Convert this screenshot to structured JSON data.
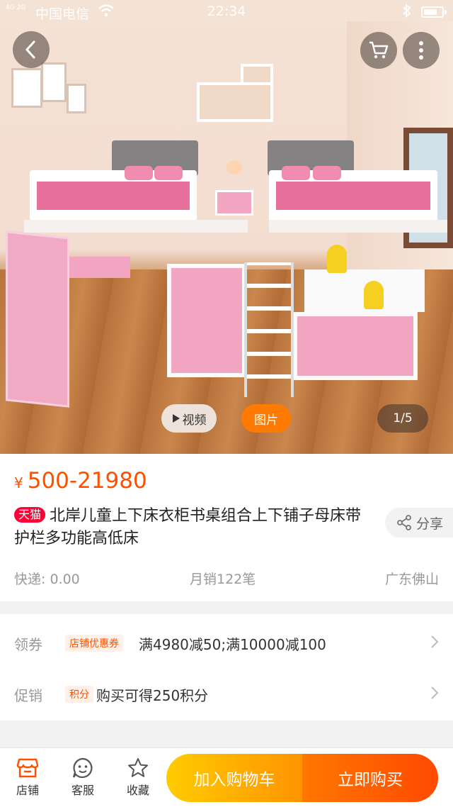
{
  "status_bar": {
    "signal": "4G 2G",
    "carrier": "中国电信",
    "time": "22:34"
  },
  "gallery": {
    "video_label": "视频",
    "image_label": "图片",
    "index": "1/5"
  },
  "product": {
    "currency": "¥",
    "price": "500-21980",
    "store_badge": "天猫",
    "title": "北岸儿童上下床衣柜书桌组合上下铺子母床带护栏多功能高低床",
    "share_label": "分享",
    "shipping": "快递: 0.00",
    "monthly_sales": "月销122笔",
    "location": "广东佛山"
  },
  "promotions": [
    {
      "label": "领券",
      "tag": "店铺优惠券",
      "text": "满4980减50;满10000减100"
    },
    {
      "label": "促销",
      "tag": "积分",
      "text": "购买可得250积分"
    }
  ],
  "bottom_bar": {
    "shop_label": "店铺",
    "service_label": "客服",
    "favorite_label": "收藏",
    "add_to_cart": "加入购物车",
    "buy_now": "立即购买"
  },
  "colors": {
    "accent": "#ff5000",
    "tmall_red": "#ff0036",
    "cart_yellow": "#ffcb00",
    "buy_orange": "#ff4900"
  },
  "icons": [
    "back-icon",
    "cart-icon",
    "more-icon",
    "play-icon",
    "share-icon",
    "shop-icon",
    "service-icon",
    "star-icon",
    "chevron-right-icon",
    "wifi-icon",
    "bluetooth-icon",
    "battery-icon"
  ]
}
